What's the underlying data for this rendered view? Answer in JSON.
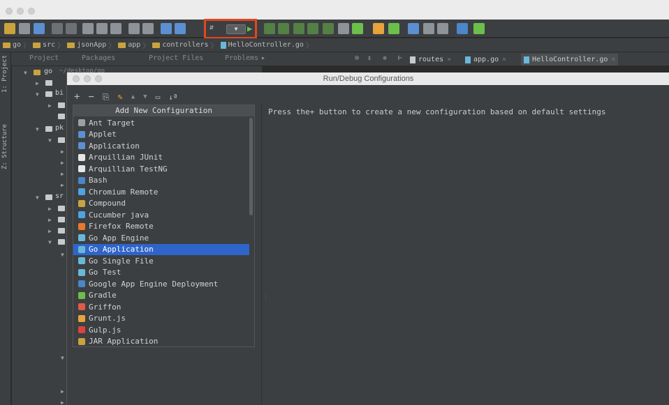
{
  "window": {
    "title": ""
  },
  "breadcrumb": {
    "items": [
      "go",
      "src",
      "jsonApp",
      "app",
      "controllers",
      "HelloController.go"
    ]
  },
  "tool_tabs": {
    "project": "Project",
    "packages": "Packages",
    "project_files": "Project Files",
    "problems": "Problems"
  },
  "editor_tabs": [
    {
      "label": "routes"
    },
    {
      "label": "app.go"
    },
    {
      "label": "HelloController.go"
    }
  ],
  "side_labels": {
    "project": "1: Project",
    "structure": "Z: Structure"
  },
  "tree": {
    "root": "go",
    "root_path": "~/desktop/go",
    "folder_prefixes": [
      "bi",
      "pk",
      "sr"
    ]
  },
  "dialog": {
    "title": "Run/Debug Configurations",
    "hint": "Press the+ button to create a new configuration based on default settings"
  },
  "popup": {
    "header": "Add New Configuration",
    "selected": "Go Application",
    "items": [
      {
        "label": "Ant Target",
        "icon": "ant-icon",
        "color": "#9aa0a6"
      },
      {
        "label": "Applet",
        "icon": "applet-icon",
        "color": "#5b8fd1"
      },
      {
        "label": "Application",
        "icon": "application-icon",
        "color": "#5b8fd1"
      },
      {
        "label": "Arquillian JUnit",
        "icon": "arquillian-icon",
        "color": "#e6e6e6"
      },
      {
        "label": "Arquillian TestNG",
        "icon": "arquillian-icon",
        "color": "#e6e6e6"
      },
      {
        "label": "Bash",
        "icon": "bash-icon",
        "color": "#4a86c8"
      },
      {
        "label": "Chromium Remote",
        "icon": "chromium-icon",
        "color": "#4fa3e0"
      },
      {
        "label": "Compound",
        "icon": "compound-icon",
        "color": "#c9a33e"
      },
      {
        "label": "Cucumber java",
        "icon": "cucumber-icon",
        "color": "#4fa3e0"
      },
      {
        "label": "Firefox Remote",
        "icon": "firefox-icon",
        "color": "#e8792b"
      },
      {
        "label": "Go App Engine",
        "icon": "go-app-engine-icon",
        "color": "#6ab8d8"
      },
      {
        "label": "Go Application",
        "icon": "go-application-icon",
        "color": "#6ab8d8"
      },
      {
        "label": "Go Single File",
        "icon": "go-single-file-icon",
        "color": "#6ab8d8"
      },
      {
        "label": "Go Test",
        "icon": "go-test-icon",
        "color": "#6ab8d8"
      },
      {
        "label": "Google App Engine Deployment",
        "icon": "google-app-engine-icon",
        "color": "#4a86c8"
      },
      {
        "label": "Gradle",
        "icon": "gradle-icon",
        "color": "#6cbf4a"
      },
      {
        "label": "Griffon",
        "icon": "griffon-icon",
        "color": "#e05a4a"
      },
      {
        "label": "Grunt.js",
        "icon": "grunt-icon",
        "color": "#e6a23c"
      },
      {
        "label": "Gulp.js",
        "icon": "gulp-icon",
        "color": "#d9443b"
      },
      {
        "label": "JAR Application",
        "icon": "jar-icon",
        "color": "#c9a33e"
      }
    ]
  }
}
